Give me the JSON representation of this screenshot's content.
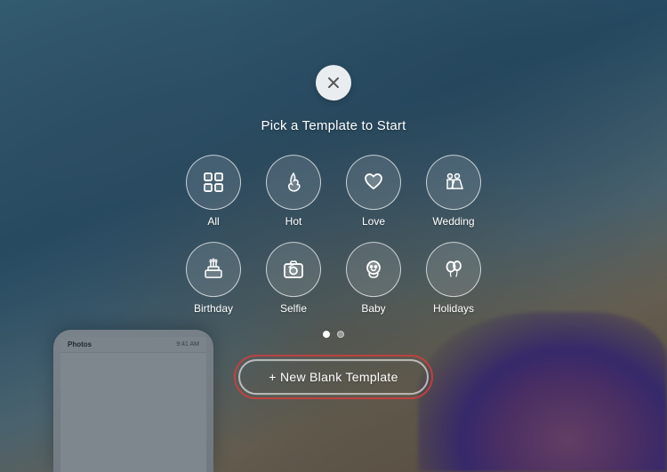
{
  "background": {
    "description": "Blurred cityscape and flowers background"
  },
  "modal": {
    "close_label": "×",
    "title": "Pick a Template to Start",
    "template_rows": [
      [
        {
          "id": "all",
          "label": "All",
          "icon": "grid"
        },
        {
          "id": "hot",
          "label": "Hot",
          "icon": "flame"
        },
        {
          "id": "love",
          "label": "Love",
          "icon": "heart"
        },
        {
          "id": "wedding",
          "label": "Wedding",
          "icon": "wedding"
        }
      ],
      [
        {
          "id": "birthday",
          "label": "Birthday",
          "icon": "birthday"
        },
        {
          "id": "selfie",
          "label": "Selfie",
          "icon": "camera"
        },
        {
          "id": "baby",
          "label": "Baby",
          "icon": "baby"
        },
        {
          "id": "holidays",
          "label": "Holidays",
          "icon": "balloons"
        }
      ]
    ],
    "pagination": {
      "active_dot": 0,
      "total_dots": 2
    },
    "new_template_button": "+ New Blank Template"
  },
  "phone": {
    "title": "Photos",
    "time": "9:41 AM"
  }
}
